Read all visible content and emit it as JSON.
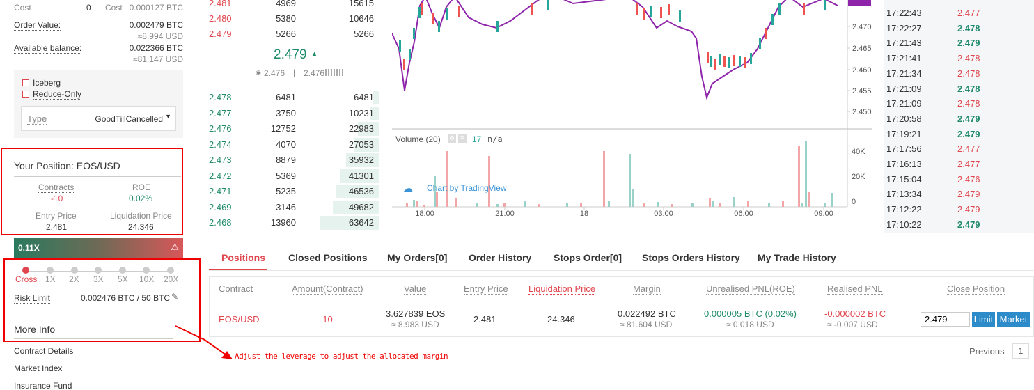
{
  "order_form": {
    "cost_label": "Cost",
    "cost_value": "0",
    "cost2_label": "Cost",
    "cost2_value": "0.000127 BTC",
    "order_value_label": "Order Value:",
    "order_value": "0.002479 BTC",
    "order_value_usd": "≈8.994 USD",
    "avail_label": "Available balance:",
    "avail_value": "0.022366 BTC",
    "avail_usd": "≈81.147 USD",
    "iceberg_label": "Iceberg",
    "reduce_label": "Reduce-Only",
    "type_label": "Type",
    "type_value": "GoodTillCancelled"
  },
  "position": {
    "title": "Your Position: EOS/USD",
    "contracts_label": "Contracts",
    "contracts_value": "-10",
    "roe_label": "ROE",
    "roe_value": "0.02%",
    "entry_label": "Entry Price",
    "entry_value": "2.481",
    "liq_label": "Liquidation Price",
    "liq_value": "24.346"
  },
  "leverage": {
    "current": "0.11X",
    "levels": [
      "Cross",
      "1X",
      "2X",
      "3X",
      "5X",
      "10X",
      "20X"
    ],
    "risk_label": "Risk Limit",
    "risk_value": "0.002476 BTC / 50 BTC"
  },
  "more_info": {
    "title": "More Info",
    "links": [
      "Contract Details",
      "Market Index",
      "Insurance Fund"
    ]
  },
  "orderbook": {
    "asks": [
      {
        "price": "2.481",
        "amount": "4969",
        "total": "15615"
      },
      {
        "price": "2.480",
        "amount": "5380",
        "total": "10646"
      },
      {
        "price": "2.479",
        "amount": "5266",
        "total": "5266"
      }
    ],
    "last_price": "2.479",
    "mark_price": "2.476",
    "index_price": "2.476",
    "bids": [
      {
        "price": "2.478",
        "amount": "6481",
        "total": "6481",
        "depth": 0.1
      },
      {
        "price": "2.477",
        "amount": "3750",
        "total": "10231",
        "depth": 0.16
      },
      {
        "price": "2.476",
        "amount": "12752",
        "total": "22983",
        "depth": 0.36
      },
      {
        "price": "2.474",
        "amount": "4070",
        "total": "27053",
        "depth": 0.43
      },
      {
        "price": "2.473",
        "amount": "8879",
        "total": "35932",
        "depth": 0.56
      },
      {
        "price": "2.472",
        "amount": "5369",
        "total": "41301",
        "depth": 0.65
      },
      {
        "price": "2.471",
        "amount": "5235",
        "total": "46536",
        "depth": 0.73
      },
      {
        "price": "2.469",
        "amount": "3146",
        "total": "49682",
        "depth": 0.78
      },
      {
        "price": "2.468",
        "amount": "13960",
        "total": "63642",
        "depth": 1.0
      }
    ]
  },
  "chart": {
    "price_ticks": [
      "2.476",
      "2.470",
      "2.465",
      "2.460",
      "2.455",
      "2.450"
    ],
    "volume_label": "Volume (20)",
    "volume_value": "17",
    "volume_na": "n/a",
    "volume_ticks": [
      "40K",
      "20K",
      "0"
    ],
    "time_ticks": [
      "18:00",
      "21:00",
      "18",
      "03:00",
      "06:00",
      "09:00"
    ],
    "watermark": "Chart by TradingView",
    "colors": {
      "up": "#26a69a",
      "down": "#ef5350",
      "ma": "#8e24aa"
    }
  },
  "trades": [
    {
      "time": "17:22:43",
      "price": "2.477",
      "side": "down"
    },
    {
      "time": "17:22:27",
      "price": "2.478",
      "side": "up"
    },
    {
      "time": "17:21:43",
      "price": "2.479",
      "side": "up"
    },
    {
      "time": "17:21:41",
      "price": "2.478",
      "side": "down"
    },
    {
      "time": "17:21:34",
      "price": "2.478",
      "side": "down"
    },
    {
      "time": "17:21:09",
      "price": "2.478",
      "side": "up"
    },
    {
      "time": "17:21:09",
      "price": "2.478",
      "side": "down"
    },
    {
      "time": "17:20:58",
      "price": "2.479",
      "side": "up"
    },
    {
      "time": "17:19:21",
      "price": "2.479",
      "side": "up"
    },
    {
      "time": "17:17:56",
      "price": "2.477",
      "side": "down"
    },
    {
      "time": "17:16:13",
      "price": "2.477",
      "side": "down"
    },
    {
      "time": "17:15:04",
      "price": "2.476",
      "side": "down"
    },
    {
      "time": "17:13:34",
      "price": "2.479",
      "side": "down"
    },
    {
      "time": "17:12:22",
      "price": "2.479",
      "side": "down"
    },
    {
      "time": "17:10:22",
      "price": "2.479",
      "side": "up"
    }
  ],
  "tabs": [
    "Positions",
    "Closed Positions",
    "My Orders[0]",
    "Order History",
    "Stops Order[0]",
    "Stops Orders History",
    "My Trade History"
  ],
  "positions_table": {
    "headers": [
      "Contract",
      "Amount(Contract)",
      "Value",
      "Entry Price",
      "Liquidation Price",
      "Margin",
      "Unrealised PNL(ROE)",
      "Realised PNL",
      "Close Position"
    ],
    "row": {
      "contract": "EOS/USD",
      "amount": "-10",
      "value": "3.627839 EOS",
      "value_usd": "≈ 8.983 USD",
      "entry": "2.481",
      "liq": "24.346",
      "margin": "0.022492 BTC",
      "margin_usd": "≈ 81.604 USD",
      "upnl": "0.000005 BTC (0.02%)",
      "upnl_usd": "≈ 0.018 USD",
      "rpnl": "-0.000002 BTC",
      "rpnl_usd": "≈ -0.007 USD",
      "close_price": "2.479",
      "limit_label": "Limit",
      "market_label": "Market"
    }
  },
  "pagination": {
    "previous": "Previous",
    "page": "1"
  },
  "annotation": "Adjust the leverage to adjust the allocated margin"
}
